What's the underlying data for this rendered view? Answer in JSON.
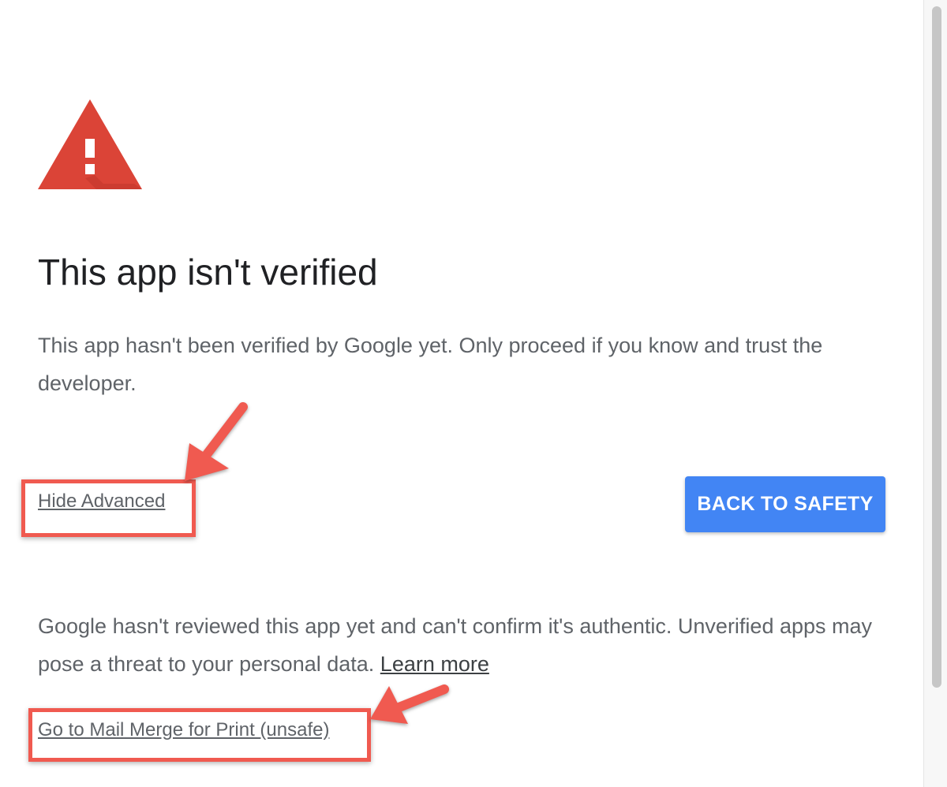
{
  "dialog": {
    "title": "This app isn't verified",
    "description": "This app hasn't been verified by Google yet. Only proceed if you know and trust the developer.",
    "hide_advanced_link": "Hide Advanced",
    "back_to_safety_button": "BACK TO SAFETY",
    "advanced_text": "Google hasn't reviewed this app yet and can't confirm it's authentic. Unverified apps may pose a threat to your personal data.",
    "learn_more_link": "Learn more",
    "go_unsafe_link": "Go to Mail Merge for Print (unsafe)"
  },
  "icons": {
    "warning": "warning-triangle-icon"
  },
  "colors": {
    "warning_red": "#db4437",
    "button_blue": "#4285f4",
    "annotation_red": "#f05a50",
    "text_gray": "#5f6368",
    "title_dark": "#202124"
  }
}
